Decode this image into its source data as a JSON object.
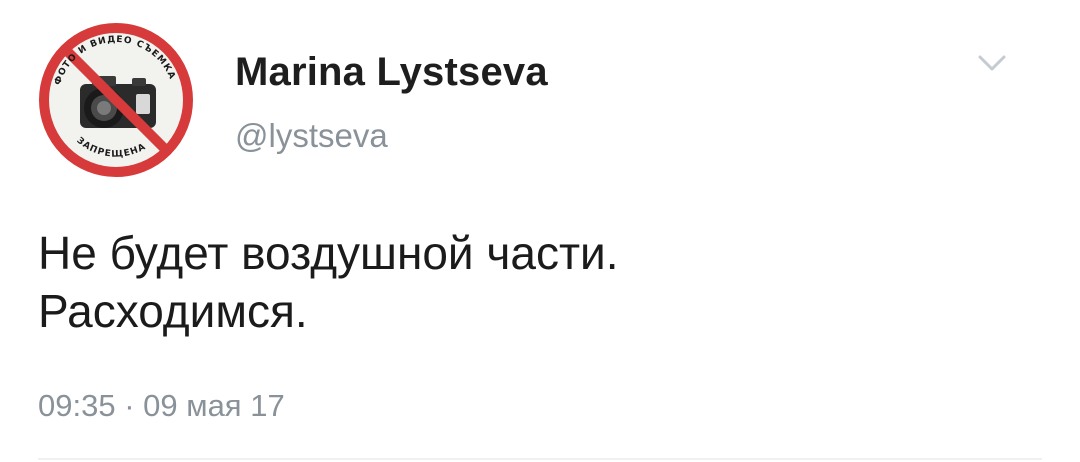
{
  "tweet": {
    "author": {
      "display_name": "Marina Lystseva",
      "handle": "@lystseva",
      "avatar": {
        "icon": "no-photography-sign",
        "ring_text_top": "ФОТО И ВИДЕО СЪЕМКА",
        "ring_text_bottom": "ЗАПРЕЩЕНА"
      }
    },
    "text_lines": [
      "Не будет воздушной части.",
      "Расходимся."
    ],
    "time": "09:35",
    "separator": "·",
    "date": "09 мая 17",
    "menu_icon": "chevron-down-icon"
  },
  "colors": {
    "name": "#1e1e1e",
    "secondary": "#8a9299",
    "body": "#1b1b1b",
    "prohibition_red": "#d63a3a",
    "chevron": "#c5cbd1"
  }
}
